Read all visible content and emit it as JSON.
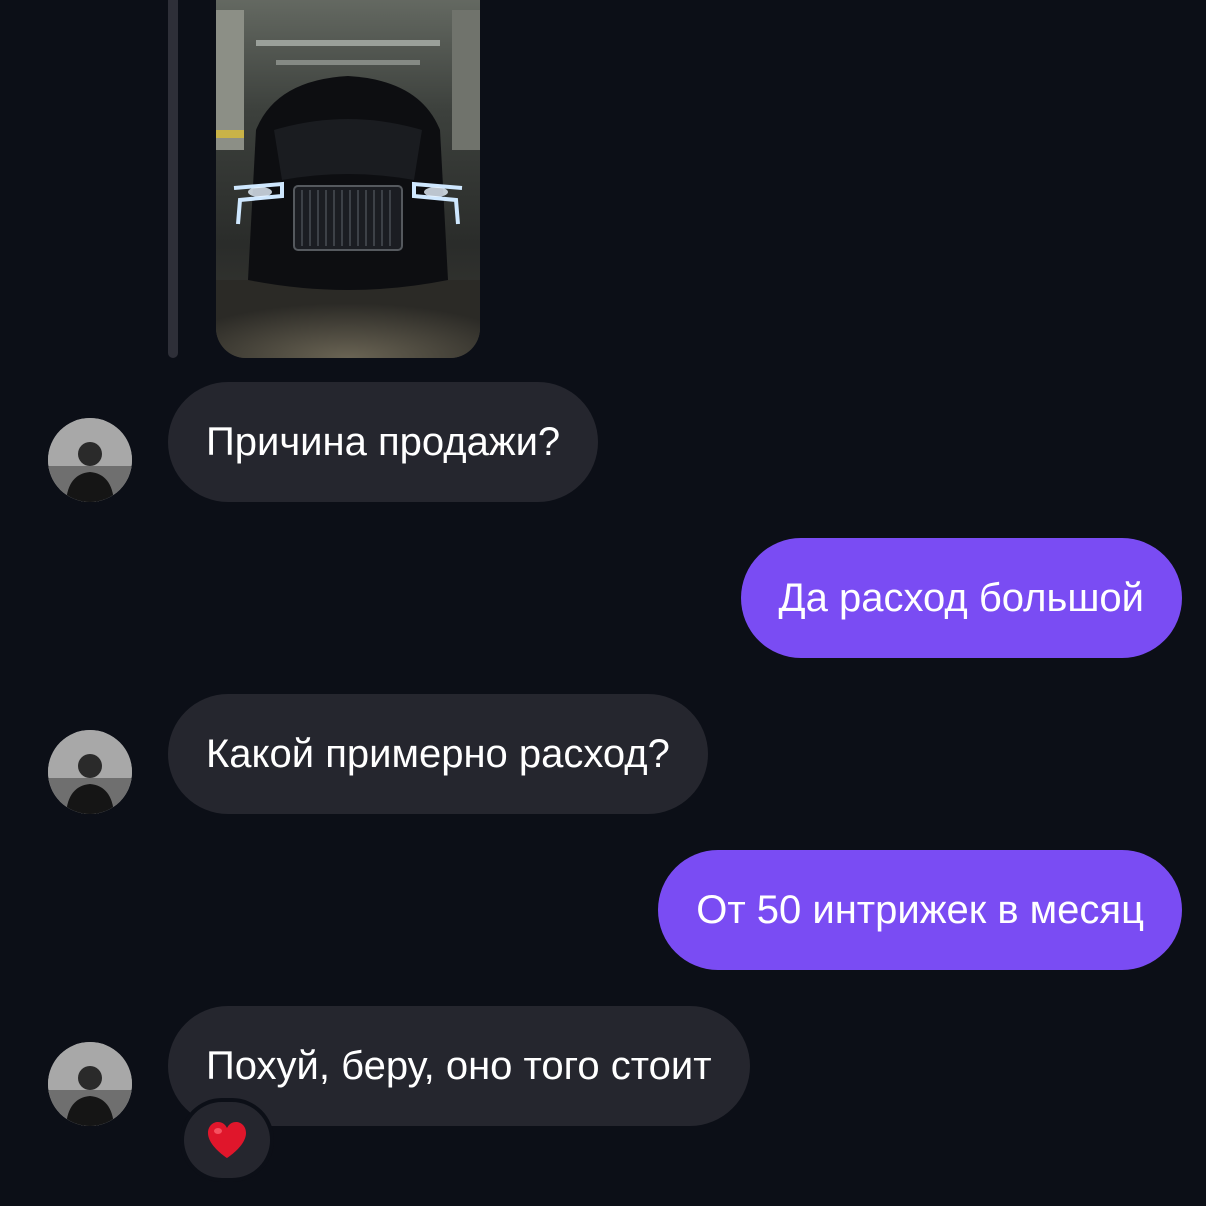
{
  "chat": {
    "messages": [
      {
        "direction": "incoming",
        "text": "Причина продажи?"
      },
      {
        "direction": "outgoing",
        "text": "Да расход большой"
      },
      {
        "direction": "incoming",
        "text": "Какой примерно расход?"
      },
      {
        "direction": "outgoing",
        "text": "От 50 интрижек в месяц"
      },
      {
        "direction": "incoming",
        "text": "Похуй, беру, оно того стоит"
      }
    ],
    "reaction": {
      "icon": "heart-icon",
      "color": "#e0162b"
    }
  },
  "colors": {
    "background": "#0c0f17",
    "incoming_bubble": "#25262e",
    "outgoing_bubble": "#7a4cf3",
    "text": "#ffffff"
  }
}
